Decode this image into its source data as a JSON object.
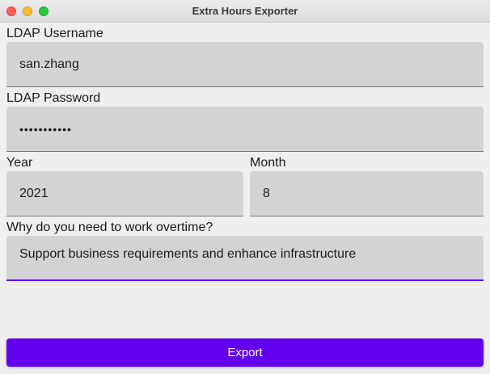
{
  "window": {
    "title": "Extra Hours Exporter"
  },
  "form": {
    "username": {
      "label": "LDAP Username",
      "value": "san.zhang"
    },
    "password": {
      "label": "LDAP Password",
      "value": "•••••••••••"
    },
    "year": {
      "label": "Year",
      "value": "2021"
    },
    "month": {
      "label": "Month",
      "value": "8"
    },
    "reason": {
      "label": "Why do you need to work overtime?",
      "value": "Support business requirements and enhance infrastructure"
    }
  },
  "actions": {
    "export_label": "Export"
  },
  "colors": {
    "accent": "#6200ee",
    "field_bg": "#d3d3d3"
  }
}
